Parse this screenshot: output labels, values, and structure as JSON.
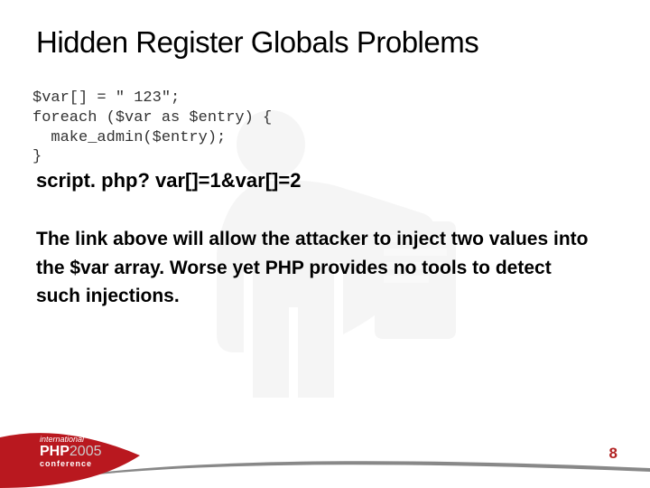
{
  "title": "Hidden Register Globals Problems",
  "code": "$var[] = \" 123\";\nforeach ($var as $entry) {\n  make_admin($entry);\n}",
  "script_line": "script. php? var[]=1&var[]=2",
  "body": "The link above will allow the attacker to inject two values into the $var array. Worse yet PHP provides no tools to detect such injections.",
  "logo": {
    "line1": "international",
    "brand": "PHP",
    "year": "2005",
    "line3": "conference"
  },
  "page_number": "8"
}
